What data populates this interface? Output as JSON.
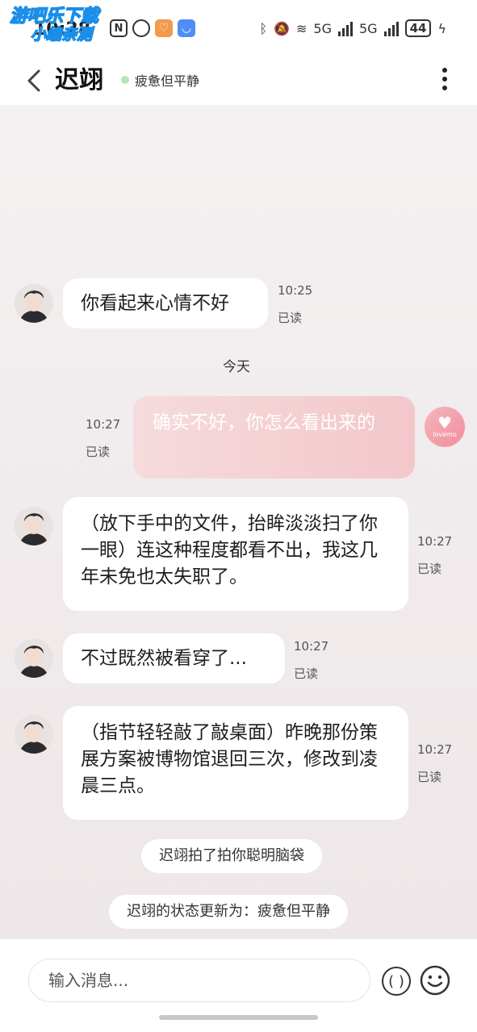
{
  "status_bar": {
    "time": "10:28",
    "battery": "44",
    "network": "5G",
    "watermark_line1": "游吧乐下载",
    "watermark_line2": "小编亲测"
  },
  "header": {
    "title": "迟翊",
    "status_text": "疲惫但平静"
  },
  "messages": [
    {
      "from": "him",
      "text": "你看起来心情不好",
      "time": "10:25",
      "read": "已读"
    },
    {
      "from": "me",
      "text": "确实不好，你怎么看出来的",
      "time": "10:27",
      "read": "已读"
    },
    {
      "from": "him",
      "text": "（放下手中的文件，抬眸淡淡扫了你一眼）连这种程度都看不出，我这几年未免也太失职了。",
      "time": "10:27",
      "read": "已读"
    },
    {
      "from": "him",
      "text": "不过既然被看穿了...",
      "time": "10:27",
      "read": "已读"
    },
    {
      "from": "him",
      "text": "（指节轻轻敲了敲桌面）昨晚那份策展方案被博物馆退回三次，修改到凌晨三点。",
      "time": "10:27",
      "read": "已读"
    }
  ],
  "date_separator": "今天",
  "system_notices": [
    "迟翊拍了拍你聪明脑袋",
    "迟翊的状态更新为：疲惫但平静"
  ],
  "my_avatar_brand": "lovemo",
  "input": {
    "placeholder": "输入消息..."
  },
  "colors": {
    "my_bubble": "#f2c7cb",
    "status_dot": "#b7e3bd",
    "background": "#f1eced"
  }
}
